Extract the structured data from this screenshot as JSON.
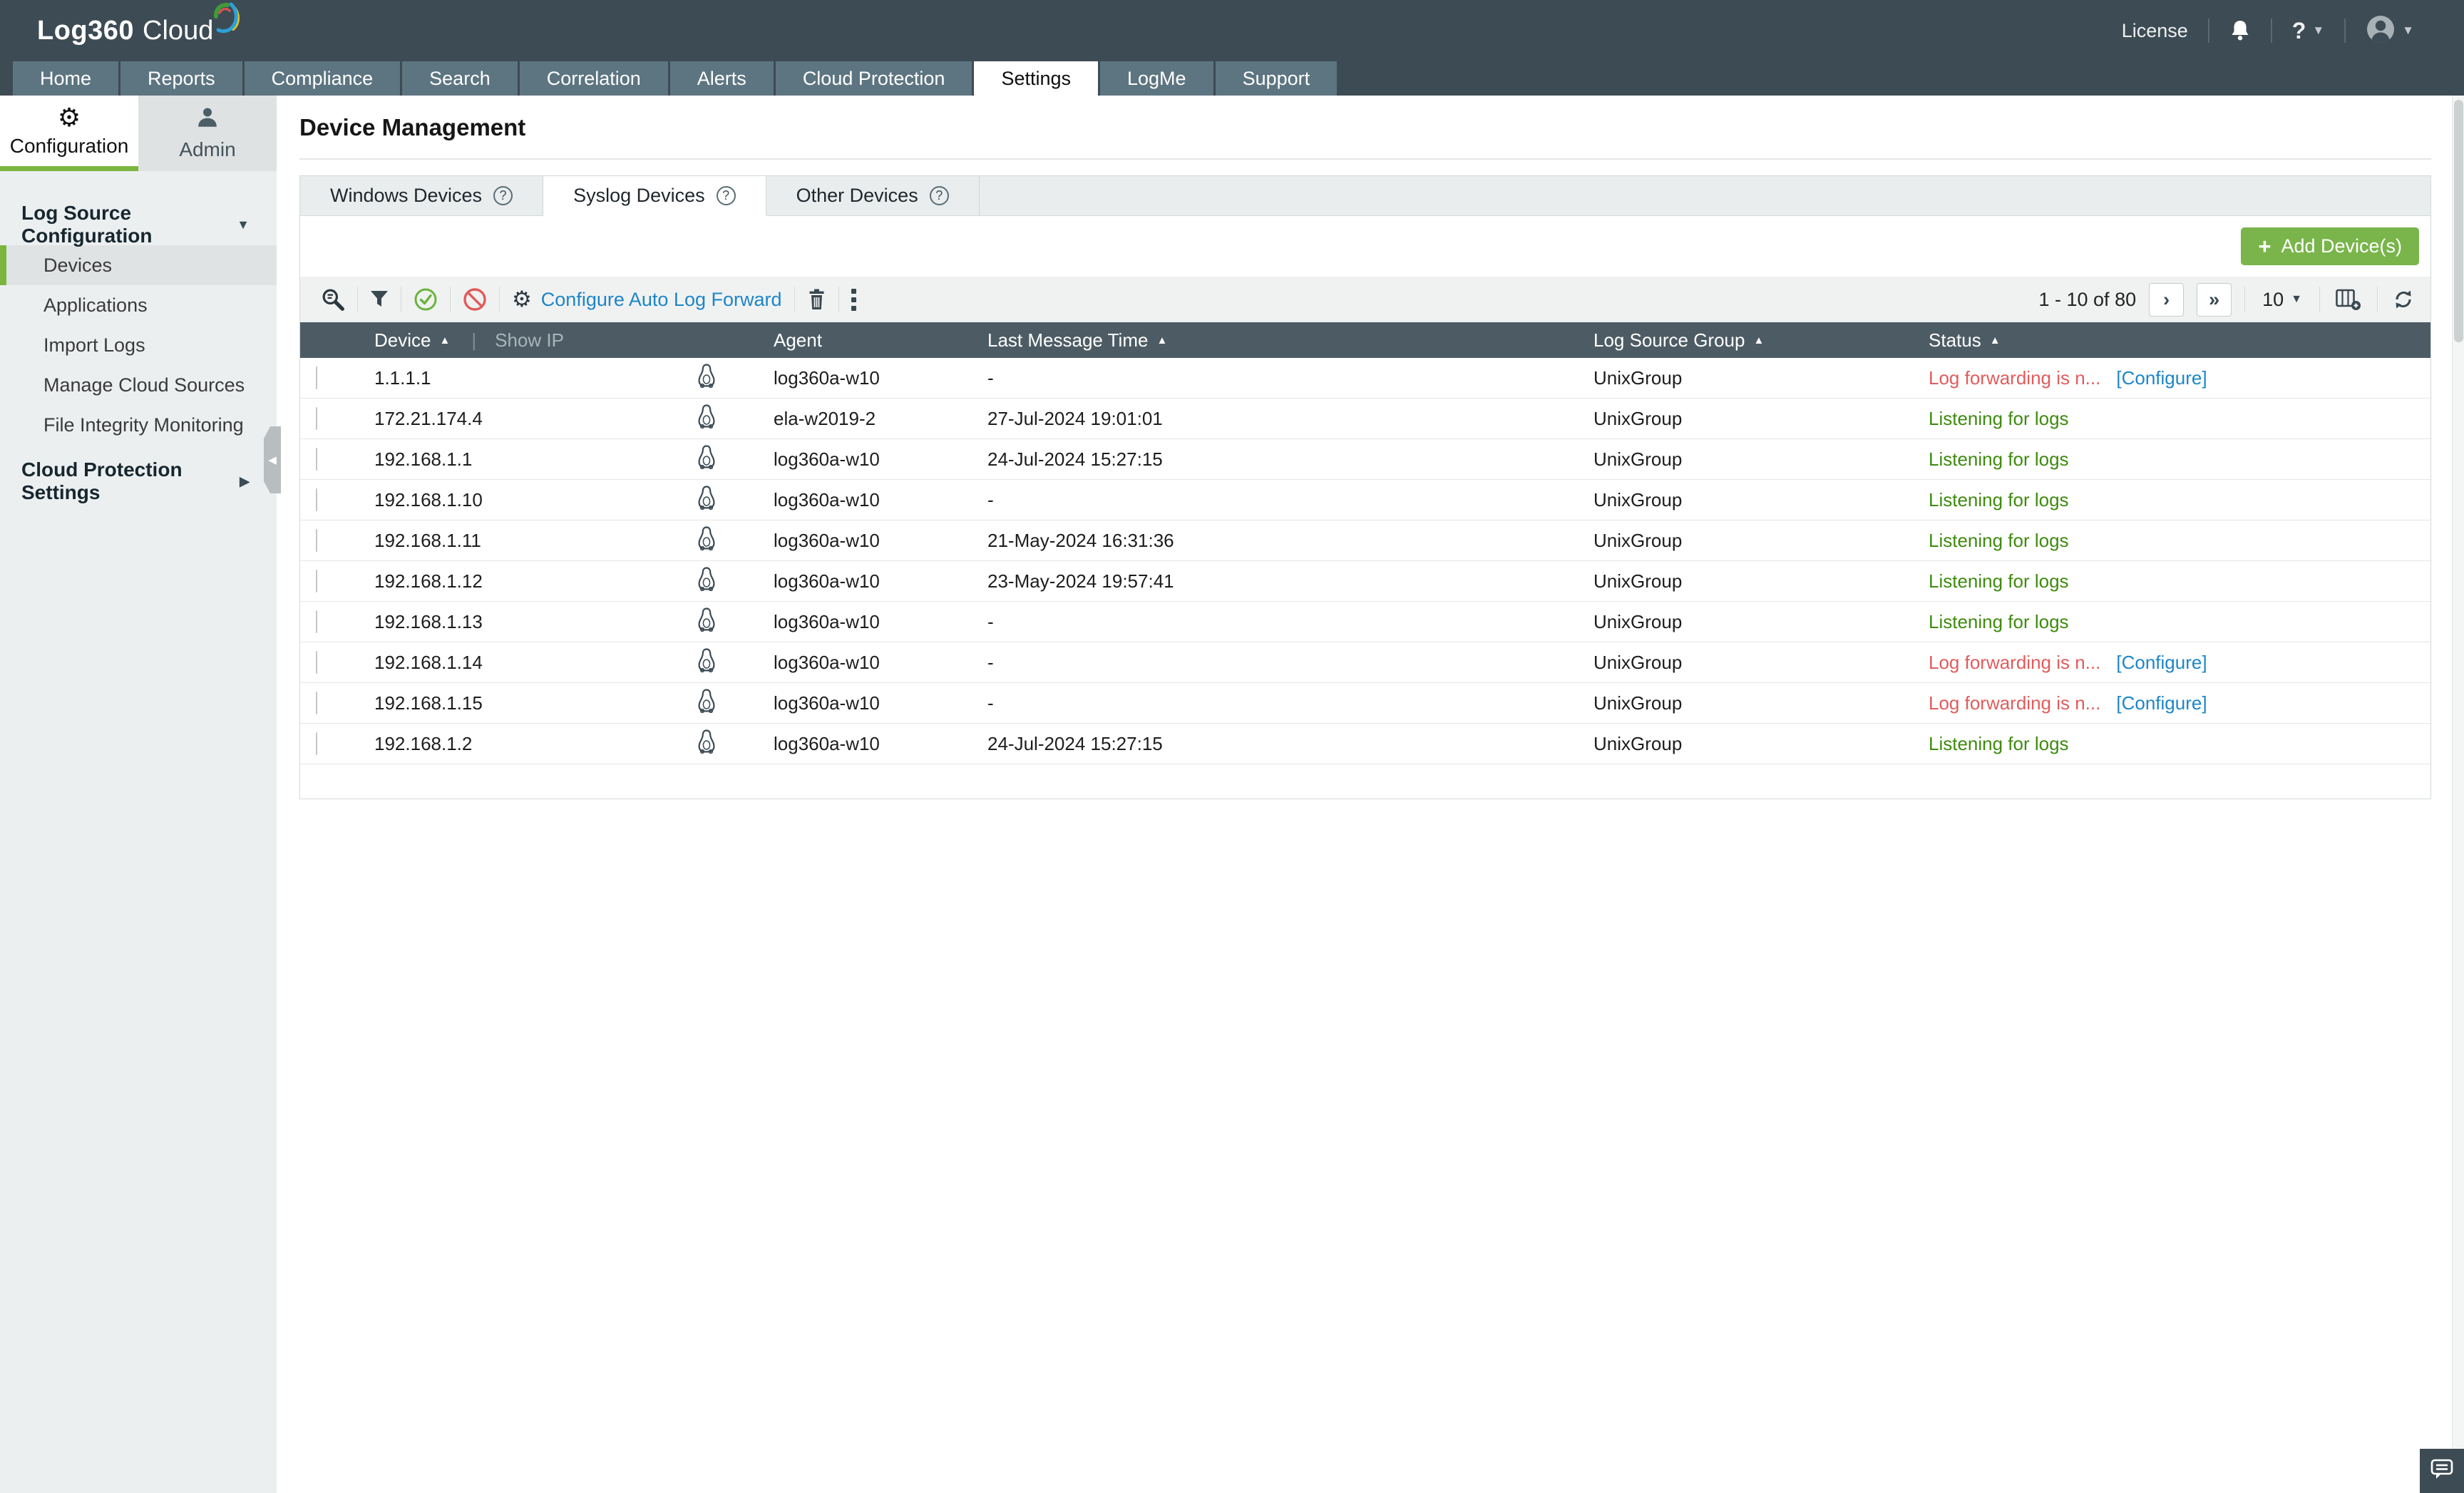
{
  "topbar": {
    "logo_primary": "Log360",
    "logo_secondary": "Cloud",
    "license": "License"
  },
  "nav": {
    "tabs": [
      {
        "label": "Home"
      },
      {
        "label": "Reports"
      },
      {
        "label": "Compliance"
      },
      {
        "label": "Search"
      },
      {
        "label": "Correlation"
      },
      {
        "label": "Alerts"
      },
      {
        "label": "Cloud Protection"
      },
      {
        "label": "Settings",
        "active": true
      },
      {
        "label": "LogMe"
      },
      {
        "label": "Support"
      }
    ]
  },
  "sidebar": {
    "mode_tabs": [
      {
        "label": "Configuration",
        "active": true
      },
      {
        "label": "Admin"
      }
    ],
    "groups": [
      {
        "label": "Log Source Configuration",
        "items": [
          {
            "label": "Devices",
            "active": true
          },
          {
            "label": "Applications"
          },
          {
            "label": "Import Logs"
          },
          {
            "label": "Manage Cloud Sources"
          },
          {
            "label": "File Integrity Monitoring"
          }
        ]
      },
      {
        "label": "Cloud Protection Settings"
      }
    ]
  },
  "page": {
    "title": "Device Management"
  },
  "device_tabs": [
    {
      "label": "Windows Devices"
    },
    {
      "label": "Syslog Devices",
      "active": true
    },
    {
      "label": "Other Devices"
    }
  ],
  "actions": {
    "add_device": "Add Device(s)",
    "configure_auto_log_forward": "Configure Auto Log Forward"
  },
  "pagination": {
    "range": "1 - 10 of 80",
    "page_size": "10"
  },
  "table": {
    "columns": {
      "device": "Device",
      "show_ip": "Show IP",
      "agent": "Agent",
      "last_message": "Last Message Time",
      "group": "Log Source Group",
      "status": "Status"
    },
    "rows": [
      {
        "device": "1.1.1.1",
        "agent": "log360a-w10",
        "last_message": "-",
        "group": "UnixGroup",
        "status": "Log forwarding is n...",
        "configure": "[Configure]"
      },
      {
        "device": "172.21.174.4",
        "agent": "ela-w2019-2",
        "last_message": "27-Jul-2024 19:01:01",
        "group": "UnixGroup",
        "status": "Listening for logs"
      },
      {
        "device": "192.168.1.1",
        "agent": "log360a-w10",
        "last_message": "24-Jul-2024 15:27:15",
        "group": "UnixGroup",
        "status": "Listening for logs"
      },
      {
        "device": "192.168.1.10",
        "agent": "log360a-w10",
        "last_message": "-",
        "group": "UnixGroup",
        "status": "Listening for logs"
      },
      {
        "device": "192.168.1.11",
        "agent": "log360a-w10",
        "last_message": "21-May-2024 16:31:36",
        "group": "UnixGroup",
        "status": "Listening for logs"
      },
      {
        "device": "192.168.1.12",
        "agent": "log360a-w10",
        "last_message": "23-May-2024 19:57:41",
        "group": "UnixGroup",
        "status": "Listening for logs"
      },
      {
        "device": "192.168.1.13",
        "agent": "log360a-w10",
        "last_message": "-",
        "group": "UnixGroup",
        "status": "Listening for logs"
      },
      {
        "device": "192.168.1.14",
        "agent": "log360a-w10",
        "last_message": "-",
        "group": "UnixGroup",
        "status": "Log forwarding is n...",
        "configure": "[Configure]"
      },
      {
        "device": "192.168.1.15",
        "agent": "log360a-w10",
        "last_message": "-",
        "group": "UnixGroup",
        "status": "Log forwarding is n...",
        "configure": "[Configure]"
      },
      {
        "device": "192.168.1.2",
        "agent": "log360a-w10",
        "last_message": "24-Jul-2024 15:27:15",
        "group": "UnixGroup",
        "status": "Listening for logs"
      }
    ]
  },
  "colors": {
    "accent_green": "#7cb53e",
    "status_ok": "#3e8b0e",
    "status_error": "#e15c5c",
    "link_blue": "#1d85c8",
    "header_slate": "#4d5c64"
  },
  "icons": {
    "gear": "⚙",
    "sort_asc": "▲",
    "caret_down": "▼",
    "caret_right": "▶",
    "caret_left": "◀",
    "next": "›",
    "last": "»",
    "plus": "+",
    "help": "?",
    "pipe": "|"
  }
}
